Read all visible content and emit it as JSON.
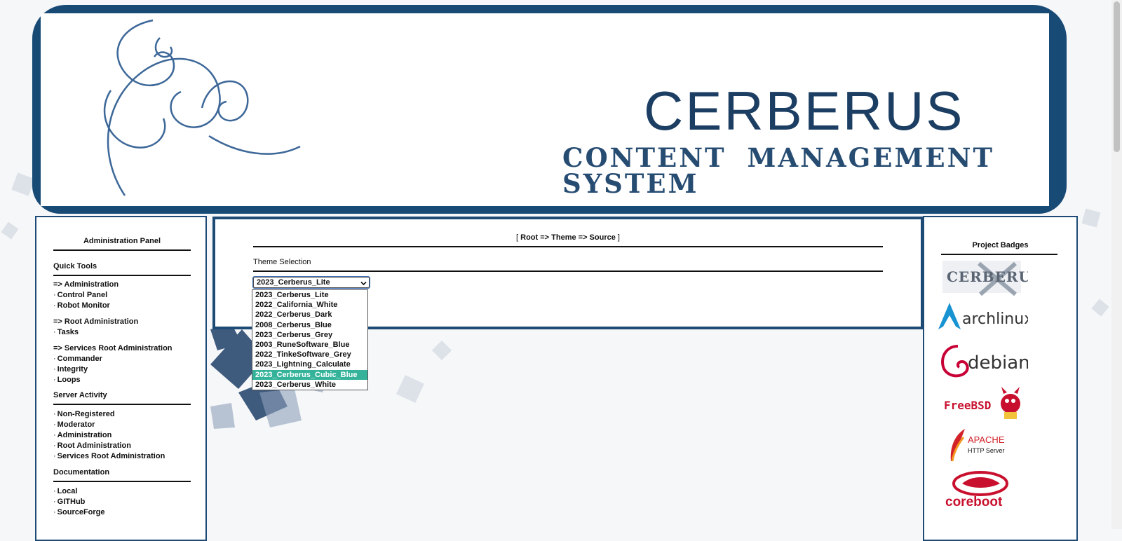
{
  "banner": {
    "title": "CERBERUS",
    "subtitle": "CONTENT MANAGEMENT SYSTEM"
  },
  "left_panel": {
    "title": "Administration Panel",
    "quick_tools": {
      "heading": "Quick Tools",
      "groups": [
        {
          "header": "=> Administration",
          "items": [
            "Control Panel",
            "Robot Monitor"
          ]
        },
        {
          "header": "=> Root Administration",
          "items": [
            "Tasks"
          ]
        },
        {
          "header": "=> Services Root Administration",
          "items": [
            "Commander",
            "Integrity",
            "Loops"
          ]
        }
      ]
    },
    "server_activity": {
      "heading": "Server Activity",
      "items": [
        "Non-Registered",
        "Moderator",
        "Administration",
        "Root Administration",
        "Services Root Administration"
      ]
    },
    "documentation": {
      "heading": "Documentation",
      "items": [
        "Local",
        "GITHub",
        "SourceForge"
      ]
    },
    "bullet": "·"
  },
  "center": {
    "breadcrumb": {
      "open": "[",
      "path": "Root => Theme => Source",
      "close": "]"
    },
    "section_label": "Theme Selection",
    "select": {
      "value": "2023_Cerberus_Lite",
      "chevron": "⌄",
      "options": [
        "2023_Cerberus_Lite",
        "2022_California_White",
        "2022_Cerberus_Dark",
        "2008_Cerberus_Blue",
        "2023_Cerberus_Grey",
        "2003_RuneSoftware_Blue",
        "2022_TinkeSoftware_Grey",
        "2023_Lightning_Calculate",
        "2023_Cerberus_Cubic_Blue",
        "2023_Cerberus_White"
      ],
      "highlighted": "2023_Cerberus_Cubic_Blue"
    }
  },
  "right_panel": {
    "title": "Project Badges",
    "badges": [
      {
        "name": "cerberus-badge",
        "text": "CERBERUS"
      },
      {
        "name": "archlinux-badge",
        "text": "archlinux"
      },
      {
        "name": "debian-badge",
        "text": "debian"
      },
      {
        "name": "freebsd-badge",
        "text": "FreeBSD"
      },
      {
        "name": "apache-badge",
        "text": "APACHE",
        "subtext": "HTTP Server"
      },
      {
        "name": "coreboot-badge",
        "text": "coreboot"
      }
    ]
  },
  "colors": {
    "banner_blue": "#174a75",
    "title_blue": "#1c3e63",
    "highlight": "#34b39a"
  }
}
